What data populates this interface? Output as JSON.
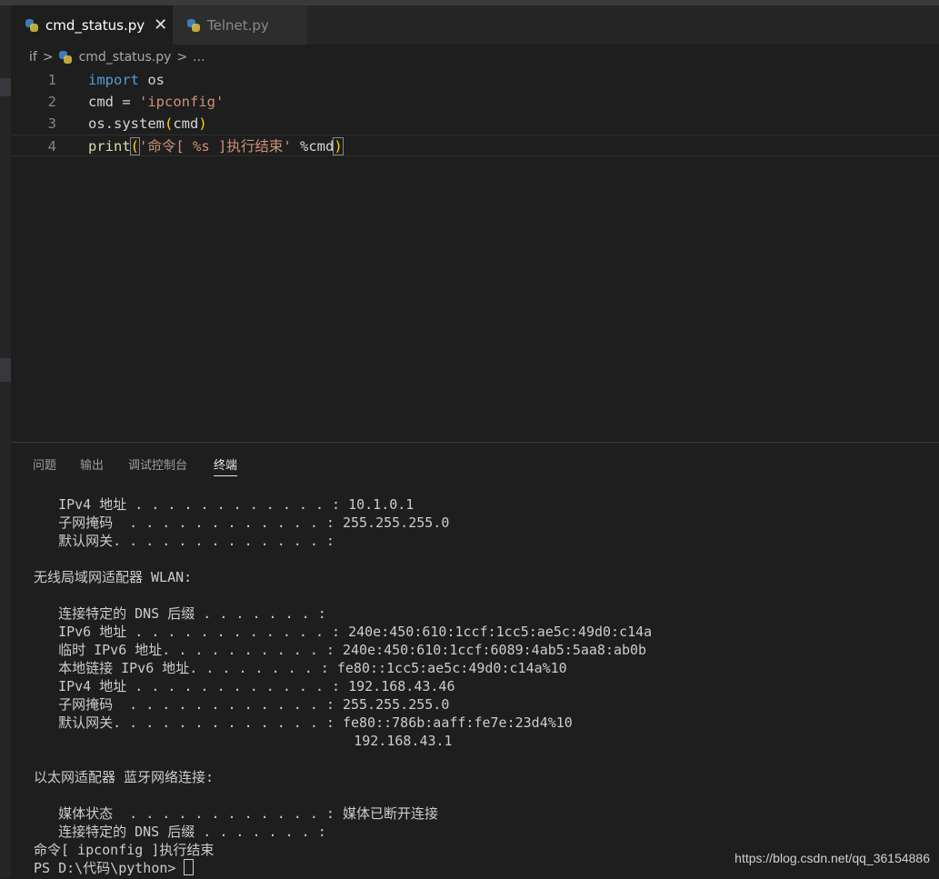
{
  "tabs": [
    {
      "label": "cmd_status.py",
      "active": true,
      "close": "✕"
    },
    {
      "label": "Telnet.py",
      "active": false
    }
  ],
  "breadcrumb": {
    "folder": "if",
    "sep": ">",
    "file": "cmd_status.py",
    "more": "..."
  },
  "editor": {
    "lines": [
      {
        "num": "1",
        "tokens": [
          {
            "t": "import",
            "c": "kw"
          },
          {
            "t": " os",
            "c": "id"
          }
        ]
      },
      {
        "num": "2",
        "tokens": [
          {
            "t": "cmd = ",
            "c": "id"
          },
          {
            "t": "'ipconfig'",
            "c": "str"
          }
        ]
      },
      {
        "num": "3",
        "tokens": [
          {
            "t": "os.system",
            "c": "id"
          },
          {
            "t": "(",
            "c": "br"
          },
          {
            "t": "cmd",
            "c": "id"
          },
          {
            "t": ")",
            "c": "br"
          }
        ]
      },
      {
        "num": "4",
        "tokens": [
          {
            "t": "print",
            "c": "fn"
          },
          {
            "t": "(",
            "c": "br brmatch"
          },
          {
            "t": "'命令[ %s ]执行结束'",
            "c": "str"
          },
          {
            "t": " %cmd",
            "c": "id"
          },
          {
            "t": ")",
            "c": "br brmatch"
          }
        ]
      }
    ]
  },
  "panel": {
    "tabs": [
      {
        "label": "问题",
        "active": false
      },
      {
        "label": "输出",
        "active": false
      },
      {
        "label": "调试控制台",
        "active": false
      },
      {
        "label": "终端",
        "active": true
      }
    ]
  },
  "terminal": {
    "lines": [
      "   IPv4 地址 . . . . . . . . . . . . : 10.1.0.1",
      "   子网掩码  . . . . . . . . . . . . : 255.255.255.0",
      "   默认网关. . . . . . . . . . . . . :",
      "",
      "无线局域网适配器 WLAN:",
      "",
      "   连接特定的 DNS 后缀 . . . . . . . :",
      "   IPv6 地址 . . . . . . . . . . . . : 240e:450:610:1ccf:1cc5:ae5c:49d0:c14a",
      "   临时 IPv6 地址. . . . . . . . . . : 240e:450:610:1ccf:6089:4ab5:5aa8:ab0b",
      "   本地链接 IPv6 地址. . . . . . . . : fe80::1cc5:ae5c:49d0:c14a%10",
      "   IPv4 地址 . . . . . . . . . . . . : 192.168.43.46",
      "   子网掩码  . . . . . . . . . . . . : 255.255.255.0",
      "   默认网关. . . . . . . . . . . . . : fe80::786b:aaff:fe7e:23d4%10",
      "                                       192.168.43.1",
      "",
      "以太网适配器 蓝牙网络连接:",
      "",
      "   媒体状态  . . . . . . . . . . . . : 媒体已断开连接",
      "   连接特定的 DNS 后缀 . . . . . . . :",
      "命令[ ipconfig ]执行结束"
    ],
    "prompt": "PS D:\\代码\\python> "
  },
  "watermark": "https://blog.csdn.net/qq_36154886"
}
